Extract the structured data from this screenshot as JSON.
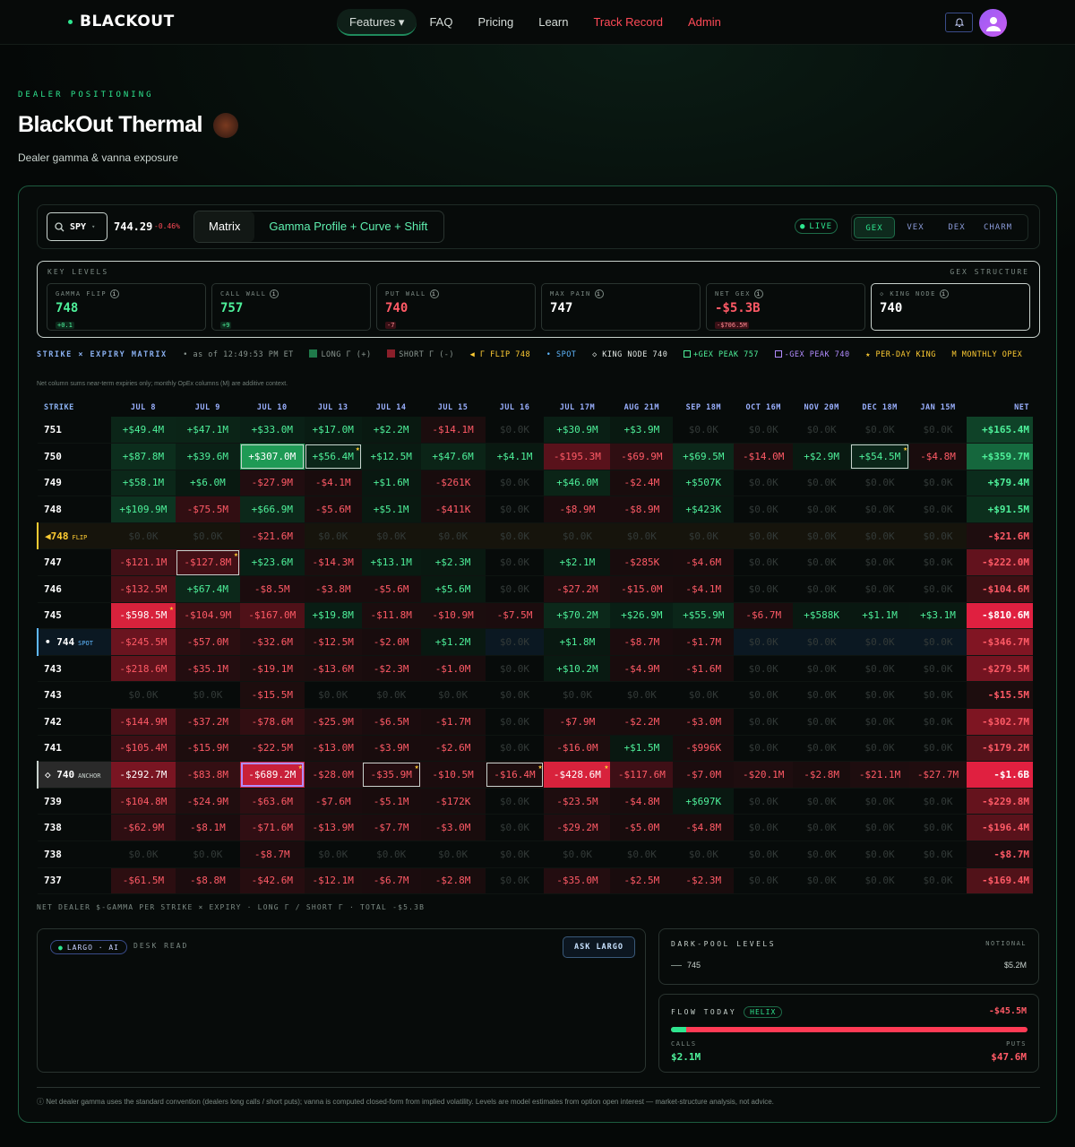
{
  "brand": {
    "name": "BLACKOUT"
  },
  "nav": {
    "items": [
      {
        "label": "Features ▾",
        "active": true,
        "red": false
      },
      {
        "label": "FAQ",
        "active": false,
        "red": false
      },
      {
        "label": "Pricing",
        "active": false,
        "red": false
      },
      {
        "label": "Learn",
        "active": false,
        "red": false
      },
      {
        "label": "Track Record",
        "active": false,
        "red": true
      },
      {
        "label": "Admin",
        "active": false,
        "red": true
      }
    ]
  },
  "header": {
    "eyebrow": "DEALER POSITIONING",
    "title": "BlackOut Thermal",
    "subtitle": "Dealer gamma & vanna exposure"
  },
  "toolbar": {
    "ticker": "SPY",
    "price": "744.29",
    "change": "-0.46%",
    "view_tabs": [
      "Matrix",
      "Gamma Profile + Curve + Shift"
    ],
    "live_label": "LIVE",
    "greek_tabs": [
      "GEX",
      "VEX",
      "DEX",
      "CHARM"
    ]
  },
  "key_levels": {
    "label": "KEY LEVELS",
    "right_label": "GEX STRUCTURE",
    "cards": [
      {
        "label": "GAMMA FLIP",
        "value": "748",
        "sub": "+0.1",
        "tone": "pos"
      },
      {
        "label": "CALL WALL",
        "value": "757",
        "sub": "+9",
        "tone": "pos"
      },
      {
        "label": "PUT WALL",
        "value": "740",
        "sub": "-7",
        "tone": "neg"
      },
      {
        "label": "MAX PAIN",
        "value": "747",
        "sub": "",
        "tone": "plain"
      },
      {
        "label": "NET GEX",
        "value": "-$5.3B",
        "sub": "-$706.5M",
        "tone": "neg"
      },
      {
        "label": "◇ KING NODE",
        "value": "740",
        "sub": "",
        "tone": "king"
      }
    ]
  },
  "legend": {
    "title": "STRIKE × EXPIRY MATRIX",
    "asof": "• as of 12:49:53 PM ET",
    "long": "LONG Γ (+)",
    "short": "SHORT Γ (-)",
    "flip": "◀ Γ FLIP 748",
    "spot": "• SPOT",
    "king": "◇ KING NODE 740",
    "gexpos": "+GEX PEAK 757",
    "gexneg": "-GEX PEAK 740",
    "perday": "★ PER-DAY KING",
    "monthly": "M MONTHLY OPEX"
  },
  "note": "Net column sums near-term expiries only; monthly OpEx columns (M) are additive context.",
  "matrix": {
    "headers": [
      "STRIKE",
      "JUL 8",
      "JUL 9",
      "JUL 10",
      "JUL 13",
      "JUL 14",
      "JUL 15",
      "JUL 16",
      "JUL 17M",
      "AUG 21M",
      "SEP 18M",
      "OCT 16M",
      "NOV 20M",
      "DEC 18M",
      "JAN 15M",
      "NET"
    ],
    "rows": [
      {
        "strike": "751",
        "tag": "",
        "type": "",
        "cells": [
          "+$49.4M",
          "+$47.1M",
          "+$33.0M",
          "+$17.0M",
          "+$2.2M",
          "-$14.1M",
          "$0.0K",
          "+$30.9M",
          "+$3.9M",
          "$0.0K",
          "$0.0K",
          "$0.0K",
          "$0.0K",
          "$0.0K"
        ],
        "net": "+$165.4M"
      },
      {
        "strike": "750",
        "tag": "",
        "type": "",
        "cells": [
          "+$87.8M",
          "+$39.6M",
          "+$307.0M",
          "+$56.4M",
          "+$12.5M",
          "+$47.6M",
          "+$4.1M",
          "-$195.3M",
          "-$69.9M",
          "+$69.5M",
          "-$14.0M",
          "+$2.9M",
          "+$54.5M",
          "-$4.8M"
        ],
        "net": "+$359.7M"
      },
      {
        "strike": "749",
        "tag": "",
        "type": "",
        "cells": [
          "+$58.1M",
          "+$6.0M",
          "-$27.9M",
          "-$4.1M",
          "+$1.6M",
          "-$261K",
          "$0.0K",
          "+$46.0M",
          "-$2.4M",
          "+$507K",
          "$0.0K",
          "$0.0K",
          "$0.0K",
          "$0.0K"
        ],
        "net": "+$79.4M"
      },
      {
        "strike": "748",
        "tag": "",
        "type": "",
        "cells": [
          "+$109.9M",
          "-$75.5M",
          "+$66.9M",
          "-$5.6M",
          "+$5.1M",
          "-$411K",
          "$0.0K",
          "-$8.9M",
          "-$8.9M",
          "+$423K",
          "$0.0K",
          "$0.0K",
          "$0.0K",
          "$0.0K"
        ],
        "net": "+$91.5M"
      },
      {
        "strike": "◀748",
        "tag": "FLIP",
        "type": "flip",
        "cells": [
          "$0.0K",
          "$0.0K",
          "-$21.6M",
          "$0.0K",
          "$0.0K",
          "$0.0K",
          "$0.0K",
          "$0.0K",
          "$0.0K",
          "$0.0K",
          "$0.0K",
          "$0.0K",
          "$0.0K",
          "$0.0K"
        ],
        "net": "-$21.6M"
      },
      {
        "strike": "747",
        "tag": "",
        "type": "",
        "cells": [
          "-$121.1M",
          "-$127.8M",
          "+$23.6M",
          "-$14.3M",
          "+$13.1M",
          "+$2.3M",
          "$0.0K",
          "+$2.1M",
          "-$285K",
          "-$4.6M",
          "$0.0K",
          "$0.0K",
          "$0.0K",
          "$0.0K"
        ],
        "net": "-$222.0M"
      },
      {
        "strike": "746",
        "tag": "",
        "type": "",
        "cells": [
          "-$132.5M",
          "+$67.4M",
          "-$8.5M",
          "-$3.8M",
          "-$5.6M",
          "+$5.6M",
          "$0.0K",
          "-$27.2M",
          "-$15.0M",
          "-$4.1M",
          "$0.0K",
          "$0.0K",
          "$0.0K",
          "$0.0K"
        ],
        "net": "-$104.6M"
      },
      {
        "strike": "745",
        "tag": "",
        "type": "",
        "cells": [
          "-$598.5M",
          "-$104.9M",
          "-$167.0M",
          "+$19.8M",
          "-$11.8M",
          "-$10.9M",
          "-$7.5M",
          "+$70.2M",
          "+$26.9M",
          "+$55.9M",
          "-$6.7M",
          "+$588K",
          "+$1.1M",
          "+$3.1M"
        ],
        "net": "-$810.6M"
      },
      {
        "strike": "• 744",
        "tag": "SPOT",
        "type": "spot",
        "cells": [
          "-$245.5M",
          "-$57.0M",
          "-$32.6M",
          "-$12.5M",
          "-$2.0M",
          "+$1.2M",
          "$0.0K",
          "+$1.8M",
          "-$8.7M",
          "-$1.7M",
          "$0.0K",
          "$0.0K",
          "$0.0K",
          "$0.0K"
        ],
        "net": "-$346.7M"
      },
      {
        "strike": "743",
        "tag": "",
        "type": "",
        "cells": [
          "-$218.6M",
          "-$35.1M",
          "-$19.1M",
          "-$13.6M",
          "-$2.3M",
          "-$1.0M",
          "$0.0K",
          "+$10.2M",
          "-$4.9M",
          "-$1.6M",
          "$0.0K",
          "$0.0K",
          "$0.0K",
          "$0.0K"
        ],
        "net": "-$279.5M"
      },
      {
        "strike": "743",
        "tag": "",
        "type": "",
        "cells": [
          "$0.0K",
          "$0.0K",
          "-$15.5M",
          "$0.0K",
          "$0.0K",
          "$0.0K",
          "$0.0K",
          "$0.0K",
          "$0.0K",
          "$0.0K",
          "$0.0K",
          "$0.0K",
          "$0.0K",
          "$0.0K"
        ],
        "net": "-$15.5M"
      },
      {
        "strike": "742",
        "tag": "",
        "type": "",
        "cells": [
          "-$144.9M",
          "-$37.2M",
          "-$78.6M",
          "-$25.9M",
          "-$6.5M",
          "-$1.7M",
          "$0.0K",
          "-$7.9M",
          "-$2.2M",
          "-$3.0M",
          "$0.0K",
          "$0.0K",
          "$0.0K",
          "$0.0K"
        ],
        "net": "-$302.7M"
      },
      {
        "strike": "741",
        "tag": "",
        "type": "",
        "cells": [
          "-$105.4M",
          "-$15.9M",
          "-$22.5M",
          "-$13.0M",
          "-$3.9M",
          "-$2.6M",
          "$0.0K",
          "-$16.0M",
          "+$1.5M",
          "-$996K",
          "$0.0K",
          "$0.0K",
          "$0.0K",
          "$0.0K"
        ],
        "net": "-$179.2M"
      },
      {
        "strike": "◇ 740",
        "tag": "ANCHOR",
        "type": "anchor",
        "cells": [
          "-$292.7M",
          "-$83.8M",
          "-$689.2M",
          "-$28.0M",
          "-$35.9M",
          "-$10.5M",
          "-$16.4M",
          "-$428.6M",
          "-$117.6M",
          "-$7.0M",
          "-$20.1M",
          "-$2.8M",
          "-$21.1M",
          "-$27.7M"
        ],
        "net": "-$1.6B"
      },
      {
        "strike": "739",
        "tag": "",
        "type": "",
        "cells": [
          "-$104.8M",
          "-$24.9M",
          "-$63.6M",
          "-$7.6M",
          "-$5.1M",
          "-$172K",
          "$0.0K",
          "-$23.5M",
          "-$4.8M",
          "+$697K",
          "$0.0K",
          "$0.0K",
          "$0.0K",
          "$0.0K"
        ],
        "net": "-$229.8M"
      },
      {
        "strike": "738",
        "tag": "",
        "type": "",
        "cells": [
          "-$62.9M",
          "-$8.1M",
          "-$71.6M",
          "-$13.9M",
          "-$7.7M",
          "-$3.0M",
          "$0.0K",
          "-$29.2M",
          "-$5.0M",
          "-$4.8M",
          "$0.0K",
          "$0.0K",
          "$0.0K",
          "$0.0K"
        ],
        "net": "-$196.4M"
      },
      {
        "strike": "738",
        "tag": "",
        "type": "",
        "cells": [
          "$0.0K",
          "$0.0K",
          "-$8.7M",
          "$0.0K",
          "$0.0K",
          "$0.0K",
          "$0.0K",
          "$0.0K",
          "$0.0K",
          "$0.0K",
          "$0.0K",
          "$0.0K",
          "$0.0K",
          "$0.0K"
        ],
        "net": "-$8.7M"
      },
      {
        "strike": "737",
        "tag": "",
        "type": "",
        "cells": [
          "-$61.5M",
          "-$8.8M",
          "-$42.6M",
          "-$12.1M",
          "-$6.7M",
          "-$2.8M",
          "$0.0K",
          "-$35.0M",
          "-$2.5M",
          "-$2.3M",
          "$0.0K",
          "$0.0K",
          "$0.0K",
          "$0.0K"
        ],
        "net": "-$169.4M"
      }
    ],
    "footer": "NET DEALER $-GAMMA PER STRIKE × EXPIRY · LONG Γ / SHORT Γ · TOTAL -$5.3B"
  },
  "largo": {
    "chip": "LARGO · AI",
    "desk": "DESK READ",
    "ask_label": "ASK LARGO"
  },
  "darkpool": {
    "title": "DARK-POOL LEVELS",
    "right_label": "NOTIONAL",
    "level": "745",
    "notional": "$5.2M"
  },
  "flow": {
    "title": "FLOW TODAY",
    "badge": "HELIX",
    "net": "-$45.5M",
    "calls_label": "CALLS",
    "puts_label": "PUTS",
    "calls_value": "$2.1M",
    "puts_value": "$47.6M",
    "calls_fraction": 0.043
  },
  "disclaimer": "ⓘ Net dealer gamma uses the standard convention (dealers long calls / short puts); vanna is computed closed-form from implied volatility. Levels are model estimates from option open interest — market-structure analysis, not advice."
}
